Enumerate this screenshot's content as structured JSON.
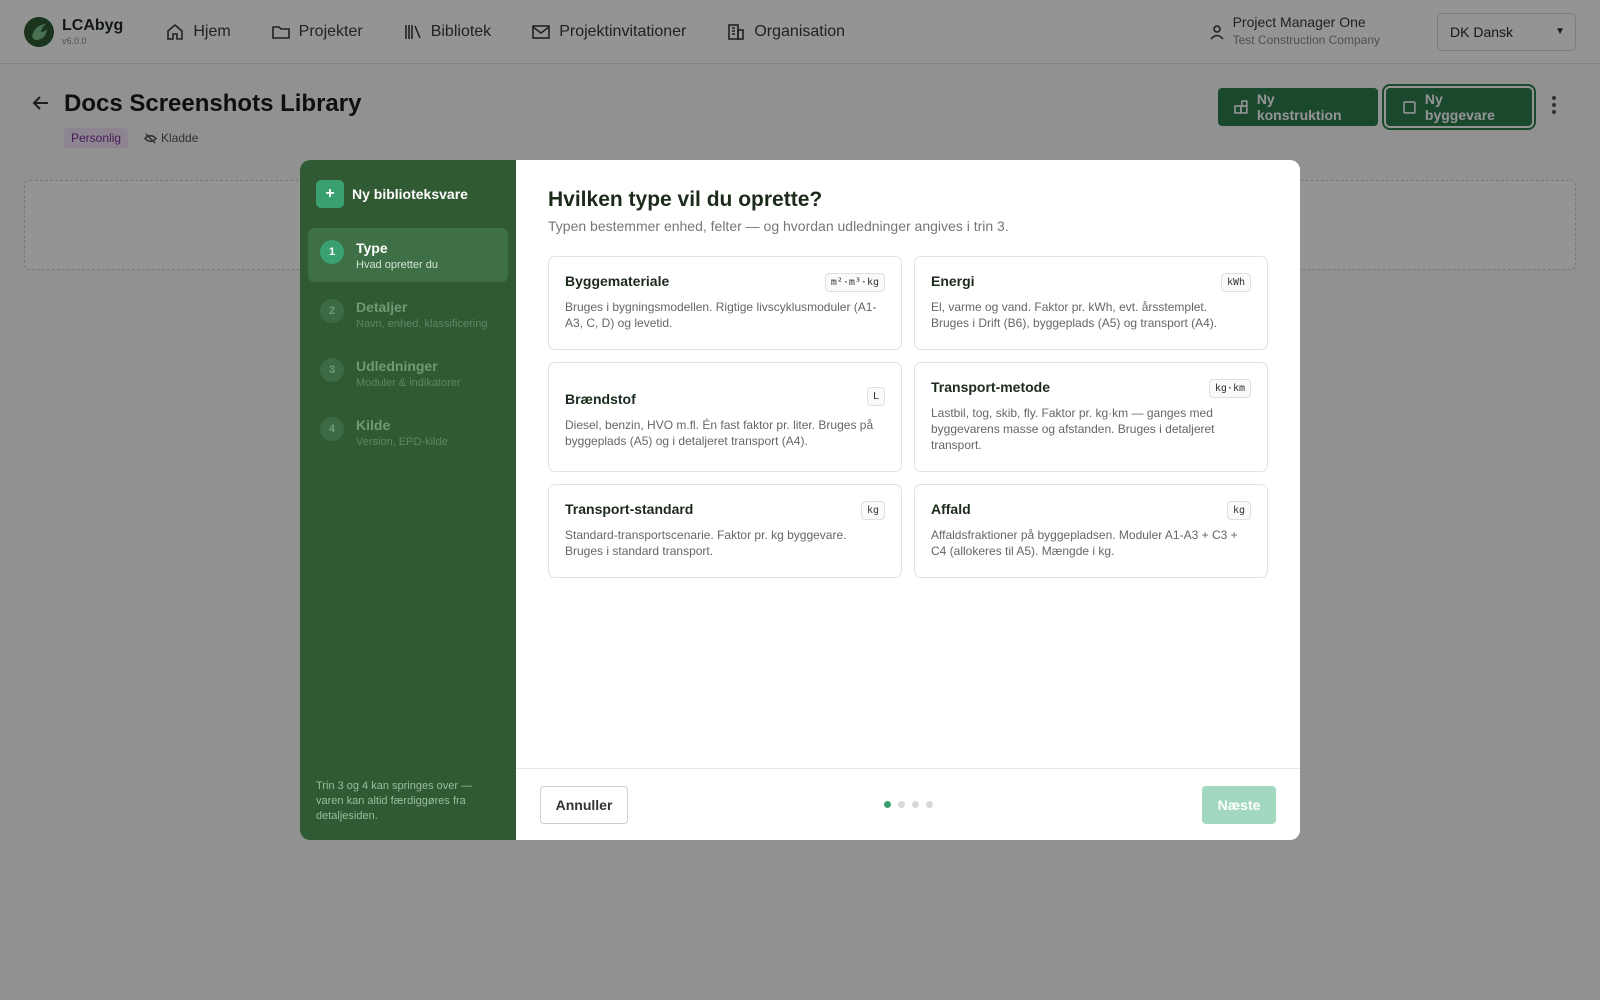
{
  "app": {
    "name": "LCAbyg",
    "version": "v6.0.0"
  },
  "nav": [
    {
      "label": "Hjem",
      "icon": "home-icon"
    },
    {
      "label": "Projekter",
      "icon": "folder-icon"
    },
    {
      "label": "Bibliotek",
      "icon": "library-icon"
    },
    {
      "label": "Projektinvitationer",
      "icon": "mail-icon"
    },
    {
      "label": "Organisation",
      "icon": "building-icon"
    }
  ],
  "user": {
    "name": "Project Manager One",
    "org": "Test Construction Company"
  },
  "language": {
    "selected": "DK Dansk"
  },
  "page": {
    "title": "Docs Screenshots Library",
    "badge_personal": "Personlig",
    "badge_draft": "Kladde",
    "btn_new_construction": "Ny konstruktion",
    "btn_new_product": "Ny byggevare"
  },
  "modal": {
    "side_title": "Ny biblioteksvare",
    "steps": [
      {
        "num": "1",
        "title": "Type",
        "sub": "Hvad opretter du",
        "active": true
      },
      {
        "num": "2",
        "title": "Detaljer",
        "sub": "Navn, enhed, klassificering",
        "active": false
      },
      {
        "num": "3",
        "title": "Udledninger",
        "sub": "Moduler & indikatorer",
        "active": false
      },
      {
        "num": "4",
        "title": "Kilde",
        "sub": "Version, EPD-kilde",
        "active": false
      }
    ],
    "side_footer": "Trin 3 og 4 kan springes over — varen kan altid færdiggøres fra detaljesiden.",
    "title": "Hvilken type vil du oprette?",
    "subtitle": "Typen bestemmer enhed, felter — og hvordan udledninger angives i trin 3.",
    "cards": [
      {
        "title": "Byggemateriale",
        "unit": "m²·m³·kg",
        "desc": "Bruges i bygningsmodellen. Rigtige livscyklusmoduler (A1-A3, C, D) og levetid."
      },
      {
        "title": "Energi",
        "unit": "kWh",
        "desc": "El, varme og vand. Faktor pr. kWh, evt. årsstemplet. Bruges i Drift (B6), byggeplads (A5) og transport (A4)."
      },
      {
        "title": "Brændstof",
        "unit": "L",
        "desc": "Diesel, benzin, HVO m.fl. Én fast faktor pr. liter. Bruges på byggeplads (A5) og i detaljeret transport (A4)."
      },
      {
        "title": "Transport-metode",
        "unit": "kg·km",
        "desc": "Lastbil, tog, skib, fly. Faktor pr. kg·km — ganges med byggevarens masse og afstanden. Bruges i detaljeret transport."
      },
      {
        "title": "Transport-standard",
        "unit": "kg",
        "desc": "Standard-transportscenarie. Faktor pr. kg byggevare. Bruges i standard transport."
      },
      {
        "title": "Affald",
        "unit": "kg",
        "desc": "Affaldsfraktioner på byggepladsen. Moduler A1-A3 + C3 + C4 (allokeres til A5). Mængde i kg."
      }
    ],
    "cancel": "Annuller",
    "next": "Næste",
    "current_step": 1,
    "total_steps": 4
  },
  "colors": {
    "primary": "#2e7d4f",
    "sidebar": "#2f5a32",
    "accent": "#3aa070"
  }
}
